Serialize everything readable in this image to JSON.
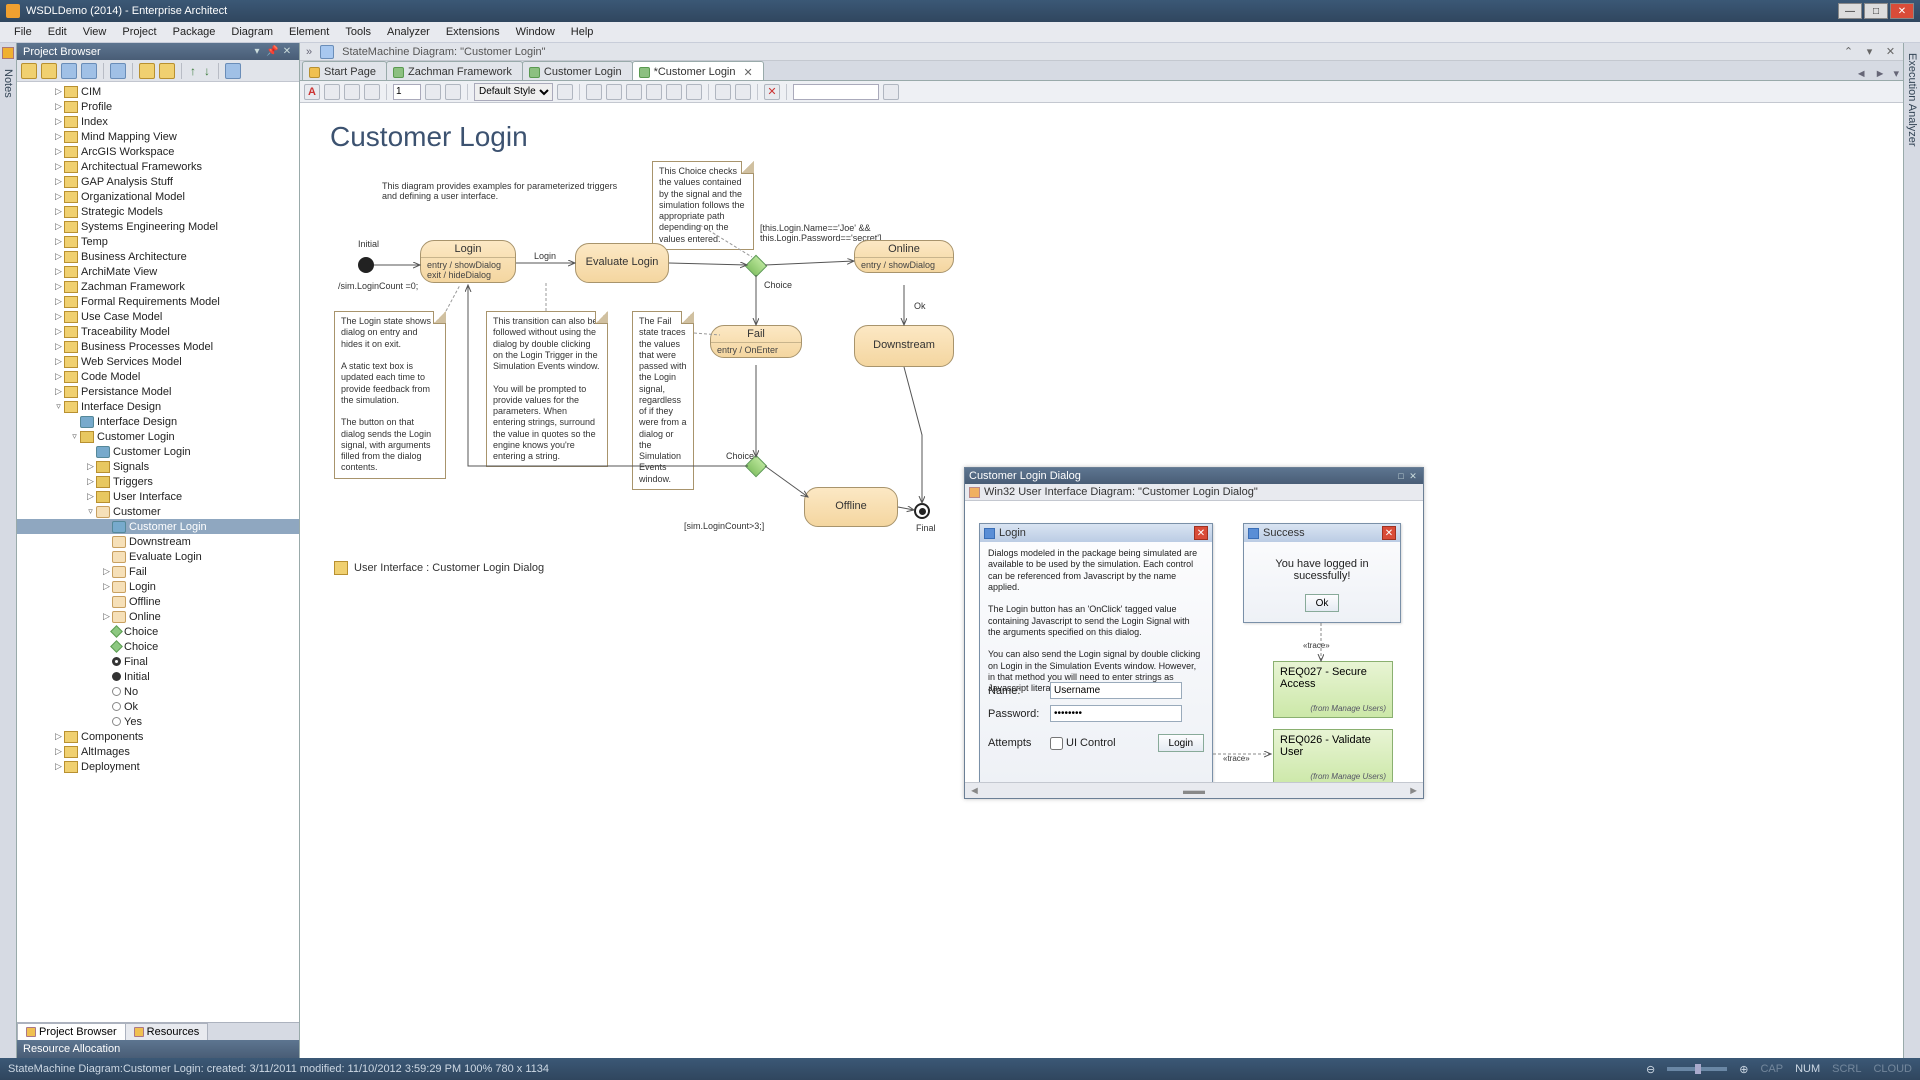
{
  "app": {
    "title": "WSDLDemo (2014) - Enterprise Architect"
  },
  "window_controls": {
    "min": "—",
    "max": "□",
    "close": "✕"
  },
  "menu": [
    "File",
    "Edit",
    "View",
    "Project",
    "Package",
    "Diagram",
    "Element",
    "Tools",
    "Analyzer",
    "Extensions",
    "Window",
    "Help"
  ],
  "rails": {
    "left": "Notes",
    "right": "Execution Analyzer"
  },
  "project_browser": {
    "title": "Project Browser",
    "items": [
      {
        "depth": 2,
        "tw": "▷",
        "icon": "pkg",
        "label": "CIM"
      },
      {
        "depth": 2,
        "tw": "▷",
        "icon": "pkg",
        "label": "Profile"
      },
      {
        "depth": 2,
        "tw": "▷",
        "icon": "pkg",
        "label": "Index"
      },
      {
        "depth": 2,
        "tw": "▷",
        "icon": "pkg",
        "label": "Mind Mapping View"
      },
      {
        "depth": 2,
        "tw": "▷",
        "icon": "pkg",
        "label": "ArcGIS Workspace"
      },
      {
        "depth": 2,
        "tw": "▷",
        "icon": "pkg",
        "label": "Architectual Frameworks"
      },
      {
        "depth": 2,
        "tw": "▷",
        "icon": "pkg",
        "label": "GAP Analysis Stuff"
      },
      {
        "depth": 2,
        "tw": "▷",
        "icon": "pkg",
        "label": "Organizational Model"
      },
      {
        "depth": 2,
        "tw": "▷",
        "icon": "pkg",
        "label": "Strategic Models"
      },
      {
        "depth": 2,
        "tw": "▷",
        "icon": "pkg",
        "label": "Systems Engineering Model"
      },
      {
        "depth": 2,
        "tw": "▷",
        "icon": "pkg",
        "label": "Temp"
      },
      {
        "depth": 2,
        "tw": "▷",
        "icon": "pkg",
        "label": "Business Architecture"
      },
      {
        "depth": 2,
        "tw": "▷",
        "icon": "pkg",
        "label": "ArchiMate View"
      },
      {
        "depth": 2,
        "tw": "▷",
        "icon": "pkg",
        "label": "Zachman Framework"
      },
      {
        "depth": 2,
        "tw": "▷",
        "icon": "pkg",
        "label": "Formal Requirements Model"
      },
      {
        "depth": 2,
        "tw": "▷",
        "icon": "pkg",
        "label": "Use Case Model"
      },
      {
        "depth": 2,
        "tw": "▷",
        "icon": "pkg",
        "label": "Traceability Model"
      },
      {
        "depth": 2,
        "tw": "▷",
        "icon": "pkg",
        "label": "Business Processes Model"
      },
      {
        "depth": 2,
        "tw": "▷",
        "icon": "pkg",
        "label": "Web Services Model"
      },
      {
        "depth": 2,
        "tw": "▷",
        "icon": "pkg",
        "label": "Code Model"
      },
      {
        "depth": 2,
        "tw": "▷",
        "icon": "pkg",
        "label": "Persistance Model"
      },
      {
        "depth": 2,
        "tw": "▿",
        "icon": "pkg",
        "label": "Interface Design"
      },
      {
        "depth": 3,
        "tw": "",
        "icon": "sm",
        "label": "Interface Design"
      },
      {
        "depth": 3,
        "tw": "▿",
        "icon": "folder",
        "label": "Customer Login"
      },
      {
        "depth": 4,
        "tw": "",
        "icon": "sm",
        "label": "Customer Login"
      },
      {
        "depth": 4,
        "tw": "▷",
        "icon": "folder",
        "label": "Signals"
      },
      {
        "depth": 4,
        "tw": "▷",
        "icon": "folder",
        "label": "Triggers"
      },
      {
        "depth": 4,
        "tw": "▷",
        "icon": "folder",
        "label": "User Interface"
      },
      {
        "depth": 4,
        "tw": "▿",
        "icon": "st",
        "label": "Customer"
      },
      {
        "depth": 5,
        "tw": "",
        "icon": "sm",
        "label": "Customer Login",
        "sel": true
      },
      {
        "depth": 5,
        "tw": "",
        "icon": "st",
        "label": "Downstream"
      },
      {
        "depth": 5,
        "tw": "",
        "icon": "st",
        "label": "Evaluate Login"
      },
      {
        "depth": 5,
        "tw": "▷",
        "icon": "st",
        "label": "Fail"
      },
      {
        "depth": 5,
        "tw": "▷",
        "icon": "st",
        "label": "Login"
      },
      {
        "depth": 5,
        "tw": "",
        "icon": "st",
        "label": "Offline"
      },
      {
        "depth": 5,
        "tw": "▷",
        "icon": "st",
        "label": "Online"
      },
      {
        "depth": 5,
        "tw": "",
        "icon": "ch",
        "label": "Choice"
      },
      {
        "depth": 5,
        "tw": "",
        "icon": "ch",
        "label": "Choice"
      },
      {
        "depth": 5,
        "tw": "",
        "icon": "fin",
        "label": "Final"
      },
      {
        "depth": 5,
        "tw": "",
        "icon": "ini",
        "label": "Initial"
      },
      {
        "depth": 5,
        "tw": "",
        "icon": "yn",
        "label": "No"
      },
      {
        "depth": 5,
        "tw": "",
        "icon": "yn",
        "label": "Ok"
      },
      {
        "depth": 5,
        "tw": "",
        "icon": "yn",
        "label": "Yes"
      },
      {
        "depth": 2,
        "tw": "▷",
        "icon": "pkg",
        "label": "Components"
      },
      {
        "depth": 2,
        "tw": "▷",
        "icon": "pkg",
        "label": "AltImages"
      },
      {
        "depth": 2,
        "tw": "▷",
        "icon": "pkg",
        "label": "Deployment"
      }
    ],
    "bottom_tabs": {
      "active": "Project Browser",
      "other": "Resources"
    },
    "alloc": "Resource Allocation"
  },
  "doc_path": "StateMachine Diagram: \"Customer Login\"",
  "tabs": [
    {
      "label": "Start Page",
      "icon": "sp"
    },
    {
      "label": "Zachman Framework",
      "icon": "g"
    },
    {
      "label": "Customer Login",
      "icon": "g"
    },
    {
      "label": "*Customer Login",
      "icon": "g",
      "active": true,
      "closable": true
    }
  ],
  "diagram_toolbar": {
    "number": "1",
    "style": "Default Style"
  },
  "diagram": {
    "title": "Customer Login",
    "intro": "This diagram provides examples for parameterized triggers and defining a user interface.",
    "note_choice": "This Choice checks the values contained by the signal and the simulation follows the appropriate path depending on the values entered.",
    "guard1": "[this.Login.Name=='Joe' &&\nthis.Login.Password=='secret']",
    "states": {
      "login": {
        "title": "Login",
        "body": "entry / showDialog\nexit / hideDialog"
      },
      "eval": {
        "title": "Evaluate Login"
      },
      "online": {
        "title": "Online",
        "body": "entry / showDialog"
      },
      "fail": {
        "title": "Fail",
        "body": "entry / OnEnter"
      },
      "down": {
        "title": "Downstream"
      },
      "offline": {
        "title": "Offline"
      }
    },
    "labels": {
      "initial": "Initial",
      "login_edge": "Login",
      "choice": "Choice",
      "ok": "Ok",
      "choice2": "Choice",
      "final": "Final",
      "guard2": "[sim.LoginCount>3;]",
      "under_initial": "/sim.LoginCount =0;"
    },
    "note_login": "The Login state shows a dialog on entry and hides it on exit.\n\nA static text box is updated each time to provide feedback from the simulation.\n\nThe button on that dialog sends the Login signal, with arguments filled from the dialog contents.",
    "note_trans": "This transition can also be followed without using the dialog by double clicking on the Login Trigger in the Simulation Events window.\n\nYou will be prompted to provide values for the parameters. When entering strings, surround the value in quotes so the engine knows you're entering a string.",
    "note_fail": "The Fail state traces the values that were passed with the Login signal, regardless of if they were from a dialog or the Simulation Events window.",
    "ui_link": "User Interface : Customer Login Dialog"
  },
  "dialog_panel": {
    "title": "Customer Login Dialog",
    "sub": "Win32 User Interface Diagram: \"Customer Login Dialog\"",
    "login_win": {
      "title": "Login",
      "text": "Dialogs modeled in the package being simulated are available to be used by the simulation. Each control can be referenced from Javascript by the name applied.\n\nThe Login button has an 'OnClick' tagged value containing Javascript to send the Login Signal with the arguments specified on this dialog.\n\nYou can also send the Login signal by double clicking on Login in the Simulation Events window. However, in that method you will need to enter strings as Javascript literals.",
      "name_lbl": "Name:",
      "name_val": "Username",
      "pw_lbl": "Password:",
      "pw_val": "••••••••",
      "att_lbl": "Attempts",
      "ui_ctrl": "UI Control",
      "login_btn": "Login"
    },
    "success_win": {
      "title": "Success",
      "msg": "You have logged in sucessfully!",
      "ok": "Ok"
    },
    "trace": "«trace»",
    "req1": {
      "title": "REQ027 - Secure Access",
      "from": "(from Manage Users)"
    },
    "req2": {
      "title": "REQ026 - Validate User",
      "from": "(from Manage Users)"
    }
  },
  "status": {
    "left": "StateMachine Diagram:Customer Login:   created: 3/11/2011   modified: 11/10/2012 3:59:29 PM   100%    780 x 1134",
    "caps": "CAP",
    "num": "NUM",
    "scrl": "SCRL",
    "cloud": "CLOUD"
  }
}
